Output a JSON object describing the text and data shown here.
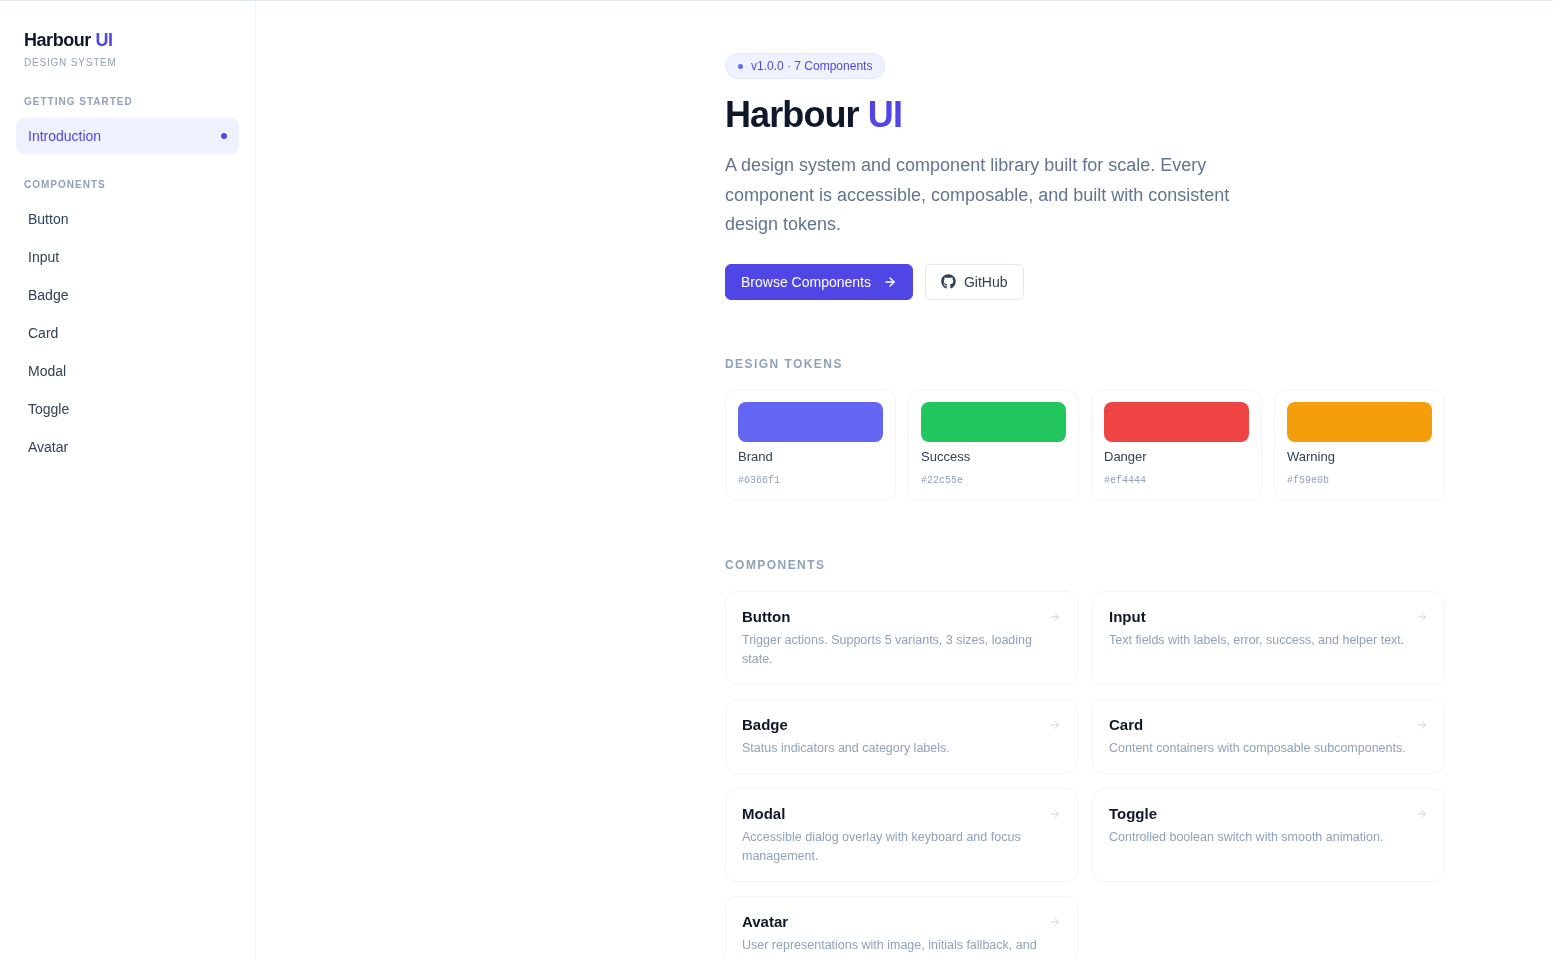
{
  "sidebar": {
    "logo": {
      "text": "Harbour",
      "accent": "UI"
    },
    "subtitle": "DESIGN SYSTEM",
    "sections": [
      {
        "heading": "GETTING STARTED",
        "items": [
          {
            "label": "Introduction",
            "selected": true
          }
        ]
      },
      {
        "heading": "COMPONENTS",
        "items": [
          {
            "label": "Button",
            "selected": false
          },
          {
            "label": "Input",
            "selected": false
          },
          {
            "label": "Badge",
            "selected": false
          },
          {
            "label": "Card",
            "selected": false
          },
          {
            "label": "Modal",
            "selected": false
          },
          {
            "label": "Toggle",
            "selected": false
          },
          {
            "label": "Avatar",
            "selected": false
          }
        ]
      }
    ]
  },
  "hero": {
    "badge": "v1.0.0 · 7 Components",
    "title": {
      "text": "Harbour",
      "accent": "UI"
    },
    "description": "A design system and component library built for scale. Every component is accessible, composable, and built with consistent design tokens.",
    "buttons": [
      {
        "label": "Browse Components",
        "kind": "primary"
      },
      {
        "label": "GitHub",
        "kind": "secondary"
      }
    ]
  },
  "tokens": {
    "heading": "DESIGN TOKENS",
    "items": [
      {
        "name": "Brand",
        "hex": "#6366f1",
        "color": "#6366f1"
      },
      {
        "name": "Success",
        "hex": "#22c55e",
        "color": "#22c55e"
      },
      {
        "name": "Danger",
        "hex": "#ef4444",
        "color": "#ef4444"
      },
      {
        "name": "Warning",
        "hex": "#f59e0b",
        "color": "#f59e0b"
      }
    ]
  },
  "components": {
    "heading": "COMPONENTS",
    "items": [
      {
        "title": "Button",
        "description": "Trigger actions. Supports 5 variants, 3 sizes, loading state."
      },
      {
        "title": "Input",
        "description": "Text fields with labels, error, success, and helper text."
      },
      {
        "title": "Badge",
        "description": "Status indicators and category labels."
      },
      {
        "title": "Card",
        "description": "Content containers with composable subcomponents."
      },
      {
        "title": "Modal",
        "description": "Accessible dialog overlay with keyboard and focus management."
      },
      {
        "title": "Toggle",
        "description": "Controlled boolean switch with smooth animation."
      },
      {
        "title": "Avatar",
        "description": "User representations with image, initials fallback, and"
      }
    ]
  }
}
